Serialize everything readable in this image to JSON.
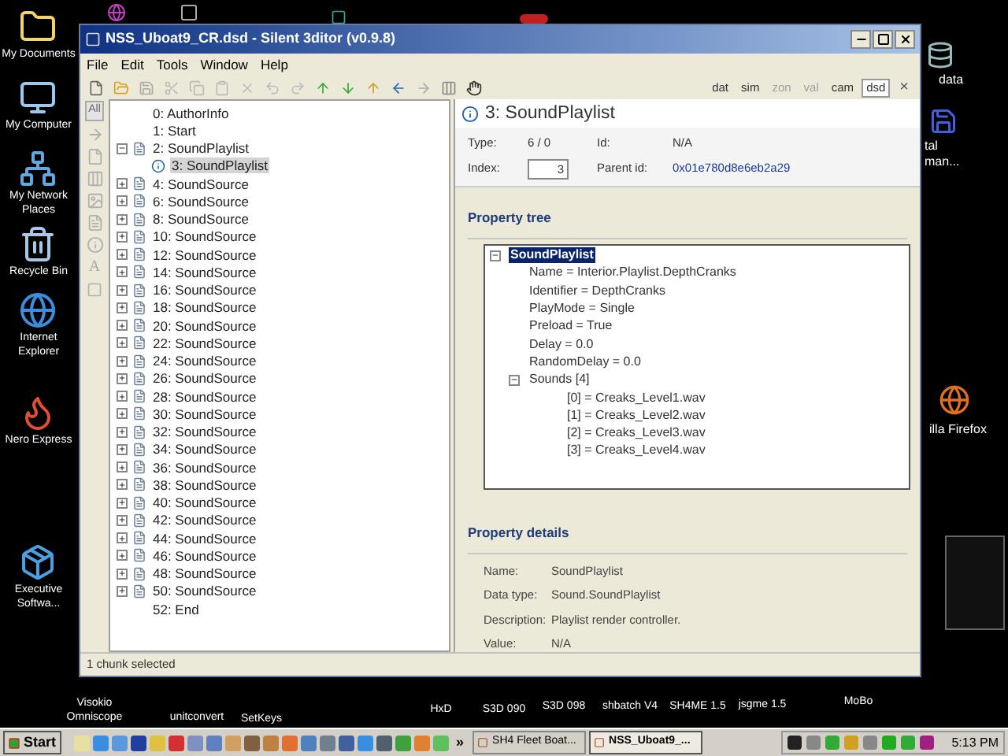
{
  "desktop": {
    "left_icons": [
      {
        "label": "My Documents"
      },
      {
        "label": "My Computer"
      },
      {
        "label": "My Network Places"
      },
      {
        "label": "Recycle Bin"
      },
      {
        "label": "Internet Explorer"
      },
      {
        "label": "Nero Express"
      },
      {
        "label": "Executive Softwa..."
      }
    ],
    "right_icons": [
      {
        "label": "data"
      },
      {
        "label": "tal man..."
      },
      {
        "label": "illa Firefox"
      }
    ],
    "bottom_icons": [
      {
        "label": "Visokio Omniscope"
      },
      {
        "label": "unitconvert"
      },
      {
        "label": "SetKeys"
      },
      {
        "label": "HxD"
      },
      {
        "label": "S3D 090"
      },
      {
        "label": "S3D 098"
      },
      {
        "label": "shbatch V4"
      },
      {
        "label": "SH4ME 1.5"
      },
      {
        "label": "jsgme 1.5"
      },
      {
        "label": "MoBo"
      }
    ]
  },
  "window": {
    "title": "NSS_Uboat9_CR.dsd - Silent 3ditor (v0.9.8)",
    "menu": [
      "File",
      "Edit",
      "Tools",
      "Window",
      "Help"
    ],
    "view_tabs": [
      {
        "label": "dat",
        "selected": false,
        "disabled": false
      },
      {
        "label": "sim",
        "selected": false,
        "disabled": false
      },
      {
        "label": "zon",
        "selected": false,
        "disabled": true
      },
      {
        "label": "val",
        "selected": false,
        "disabled": true
      },
      {
        "label": "cam",
        "selected": false,
        "disabled": false
      },
      {
        "label": "dsd",
        "selected": true,
        "disabled": false
      }
    ],
    "close_glyph": "×",
    "side_all": "All",
    "side_font": "A",
    "chunk_tree": [
      {
        "label": "0: AuthorInfo",
        "kind": "plain",
        "selected": false
      },
      {
        "label": "1: Start",
        "kind": "plain",
        "selected": false
      },
      {
        "label": "2: SoundPlaylist",
        "kind": "chunk",
        "selected": false,
        "expanded": true,
        "children": [
          {
            "label": "3: SoundPlaylist",
            "kind": "info",
            "selected": true
          }
        ]
      },
      {
        "label": "4: SoundSource",
        "kind": "chunk",
        "selected": false,
        "expanded": false
      },
      {
        "label": "6: SoundSource",
        "kind": "chunk",
        "selected": false,
        "expanded": false
      },
      {
        "label": "8: SoundSource",
        "kind": "chunk",
        "selected": false,
        "expanded": false
      },
      {
        "label": "10: SoundSource",
        "kind": "chunk",
        "selected": false,
        "expanded": false
      },
      {
        "label": "12: SoundSource",
        "kind": "chunk",
        "selected": false,
        "expanded": false
      },
      {
        "label": "14: SoundSource",
        "kind": "chunk",
        "selected": false,
        "expanded": false
      },
      {
        "label": "16: SoundSource",
        "kind": "chunk",
        "selected": false,
        "expanded": false
      },
      {
        "label": "18: SoundSource",
        "kind": "chunk",
        "selected": false,
        "expanded": false
      },
      {
        "label": "20: SoundSource",
        "kind": "chunk",
        "selected": false,
        "expanded": false
      },
      {
        "label": "22: SoundSource",
        "kind": "chunk",
        "selected": false,
        "expanded": false
      },
      {
        "label": "24: SoundSource",
        "kind": "chunk",
        "selected": false,
        "expanded": false
      },
      {
        "label": "26: SoundSource",
        "kind": "chunk",
        "selected": false,
        "expanded": false
      },
      {
        "label": "28: SoundSource",
        "kind": "chunk",
        "selected": false,
        "expanded": false
      },
      {
        "label": "30: SoundSource",
        "kind": "chunk",
        "selected": false,
        "expanded": false
      },
      {
        "label": "32: SoundSource",
        "kind": "chunk",
        "selected": false,
        "expanded": false
      },
      {
        "label": "34: SoundSource",
        "kind": "chunk",
        "selected": false,
        "expanded": false
      },
      {
        "label": "36: SoundSource",
        "kind": "chunk",
        "selected": false,
        "expanded": false
      },
      {
        "label": "38: SoundSource",
        "kind": "chunk",
        "selected": false,
        "expanded": false
      },
      {
        "label": "40: SoundSource",
        "kind": "chunk",
        "selected": false,
        "expanded": false
      },
      {
        "label": "42: SoundSource",
        "kind": "chunk",
        "selected": false,
        "expanded": false
      },
      {
        "label": "44: SoundSource",
        "kind": "chunk",
        "selected": false,
        "expanded": false
      },
      {
        "label": "46: SoundSource",
        "kind": "chunk",
        "selected": false,
        "expanded": false
      },
      {
        "label": "48: SoundSource",
        "kind": "chunk",
        "selected": false,
        "expanded": false
      },
      {
        "label": "50: SoundSource",
        "kind": "chunk",
        "selected": false,
        "expanded": false
      },
      {
        "label": "52: End",
        "kind": "plain",
        "selected": false
      }
    ],
    "header": "3: SoundPlaylist",
    "info": {
      "type_label": "Type:",
      "type": "6 / 0",
      "id_label": "Id:",
      "id": "N/A",
      "index_label": "Index:",
      "index": "3",
      "parent_label": "Parent id:",
      "parent": "0x01e780d8e6eb2a29"
    },
    "property_tree": {
      "title": "Property tree",
      "root": {
        "label": "SoundPlaylist",
        "selected": true,
        "expanded": true,
        "children": [
          {
            "label": "Name = Interior.Playlist.DepthCranks",
            "selected": false
          },
          {
            "label": "Identifier = DepthCranks",
            "selected": false
          },
          {
            "label": "PlayMode = Single",
            "selected": false
          },
          {
            "label": "Preload = True",
            "selected": false
          },
          {
            "label": "Delay = 0.0",
            "selected": false
          },
          {
            "label": "RandomDelay = 0.0",
            "selected": false
          },
          {
            "label": "Sounds [4]",
            "selected": false,
            "expanded": true,
            "children": [
              {
                "label": "[0] = Creaks_Level1.wav",
                "selected": false
              },
              {
                "label": "[1] = Creaks_Level2.wav",
                "selected": false
              },
              {
                "label": "[2] = Creaks_Level3.wav",
                "selected": false
              },
              {
                "label": "[3] = Creaks_Level4.wav",
                "selected": false
              }
            ]
          }
        ]
      }
    },
    "property_details": {
      "title": "Property details",
      "rows": [
        {
          "label": "Name:",
          "value": "SoundPlaylist"
        },
        {
          "label": "Data type:",
          "value": "Sound.SoundPlaylist"
        },
        {
          "label": "Description:",
          "value": "Playlist render controller."
        },
        {
          "label": "Value:",
          "value": "N/A"
        }
      ]
    },
    "status_bar": "1 chunk selected"
  },
  "taskbar": {
    "start": "Start",
    "more": "»",
    "tasks": [
      {
        "label": "SH4 Fleet Boat...",
        "selected": false
      },
      {
        "label": "NSS_Uboat9_...",
        "selected": true
      }
    ],
    "clock": "5:13 PM"
  }
}
